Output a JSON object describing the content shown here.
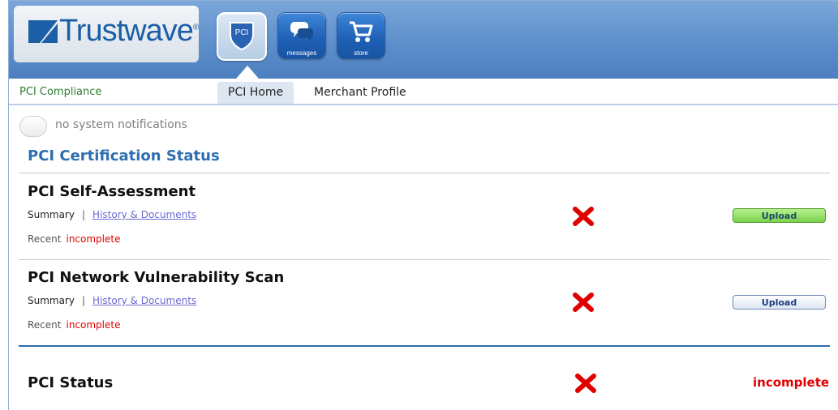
{
  "header": {
    "logo_text": "Trustwave",
    "logo_tm": "®",
    "buttons": [
      {
        "label": "",
        "icon": "shield-pci-icon",
        "badge": "PCI"
      },
      {
        "label": "messages",
        "icon": "chat-bubbles-icon"
      },
      {
        "label": "store",
        "icon": "shopping-cart-icon"
      }
    ]
  },
  "nav": {
    "title": "PCI Compliance",
    "tabs": [
      {
        "label": "PCI Home",
        "active": true
      },
      {
        "label": "Merchant Profile",
        "active": false
      }
    ]
  },
  "notifications": {
    "text": "no system notifications"
  },
  "main": {
    "section_title": "PCI Certification Status",
    "items": [
      {
        "title": "PCI Self-Assessment",
        "summary_label": "Summary",
        "separator": "|",
        "history_link": "History & Documents",
        "recent_label": "Recent",
        "recent_status": "incomplete",
        "upload_label": "Upload"
      },
      {
        "title": "PCI Network Vulnerability Scan",
        "summary_label": "Summary",
        "separator": "|",
        "history_link": "History & Documents",
        "recent_label": "Recent",
        "recent_status": "incomplete",
        "upload_label": "Upload"
      }
    ],
    "overall": {
      "label": "PCI Status",
      "status": "incomplete"
    }
  },
  "colors": {
    "header_blue": "#5d8fcc",
    "nav_green": "#2d7d30",
    "section_blue": "#2e6eb0",
    "status_red": "#e00000",
    "upload_green": "#7cd24c"
  }
}
